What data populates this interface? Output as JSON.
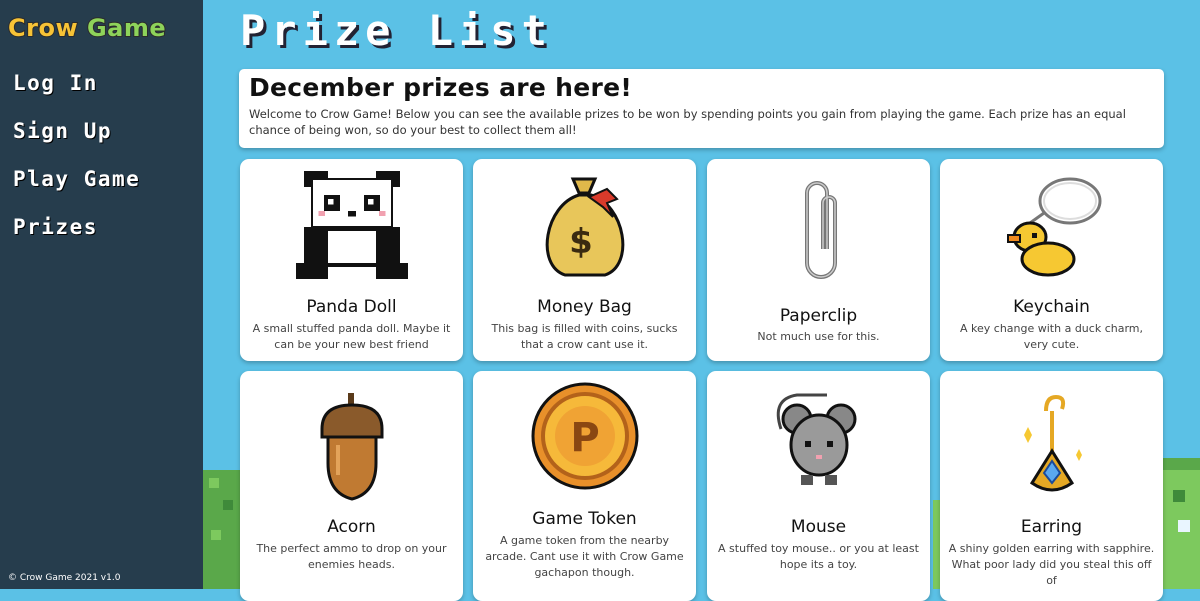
{
  "sidebar": {
    "logo_part1": "Crow",
    "logo_part2": "Game",
    "items": [
      {
        "label": "Log In"
      },
      {
        "label": "Sign Up"
      },
      {
        "label": "Play Game"
      },
      {
        "label": "Prizes"
      }
    ],
    "copyright": "© Crow Game 2021 v1.0"
  },
  "main": {
    "title": "Prize List",
    "intro_heading": "December prizes are here!",
    "intro_text": "Welcome to Crow Game! Below you can see the available prizes to be won by spending points you gain from playing the game. Each prize has an equal chance of being won, so do your best to collect them all!"
  },
  "prizes": [
    {
      "name": "Panda Doll",
      "description": "A small stuffed panda doll. Maybe it can be your new best friend",
      "icon": "panda-icon"
    },
    {
      "name": "Money Bag",
      "description": "This bag is filled with coins, sucks that a crow cant use it.",
      "icon": "money-bag-icon"
    },
    {
      "name": "Paperclip",
      "description": "Not much use for this.",
      "icon": "paperclip-icon"
    },
    {
      "name": "Keychain",
      "description": "A key change with a duck charm, very cute.",
      "icon": "duck-keychain-icon"
    },
    {
      "name": "Acorn",
      "description": "The perfect ammo to drop on your enemies heads.",
      "icon": "acorn-icon"
    },
    {
      "name": "Game Token",
      "description": "A game token from the nearby arcade. Cant use it with Crow Game gachapon though.",
      "icon": "game-token-icon"
    },
    {
      "name": "Mouse",
      "description": "A stuffed toy mouse.. or you at least hope its a toy.",
      "icon": "mouse-icon"
    },
    {
      "name": "Earring",
      "description": "A shiny golden earring with sapphire. What poor lady did you steal this off of",
      "icon": "earring-icon"
    }
  ],
  "colors": {
    "sidebar_bg": "#263d4d",
    "page_bg": "#5bc1e6",
    "logo_yellow": "#f7c336",
    "logo_green": "#8ed35a"
  }
}
